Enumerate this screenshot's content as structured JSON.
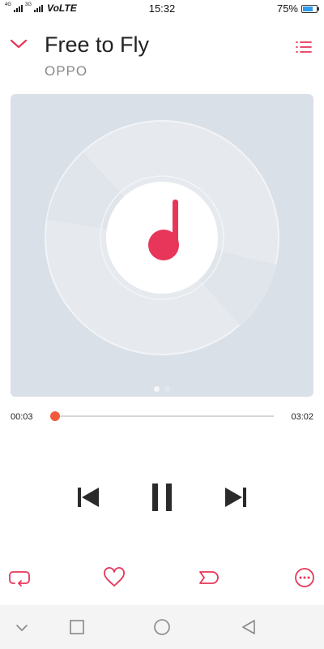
{
  "status_bar": {
    "network_tag_1": "4G",
    "network_tag_2": "3G",
    "volte": "VoLTE",
    "time": "15:32",
    "battery_percent": "75%",
    "battery_level": 0.75,
    "battery_color": "#2f9cf0"
  },
  "player": {
    "title": "Free to Fly",
    "artist": "OPPO",
    "elapsed": "00:03",
    "total": "03:02",
    "progress": 0.02,
    "accent_color": "#e8355a",
    "progress_color": "#f05a3c",
    "artwork_icon": "music-note-icon",
    "artwork_pages": 2,
    "artwork_active_page": 1
  },
  "controls": {
    "previous_icon": "skip-previous-icon",
    "play_pause_icon": "pause-icon",
    "next_icon": "skip-next-icon"
  },
  "actions": {
    "collapse_icon": "chevron-down-icon",
    "playlist_icon": "playlist-icon",
    "loop_icon": "repeat-icon",
    "favorite_icon": "heart-icon",
    "queue_icon": "queue-tag-icon",
    "more_icon": "more-icon"
  },
  "nav_bar": {
    "icons": [
      "nav-chevron-down-icon",
      "recents-square-icon",
      "home-circle-icon",
      "back-triangle-icon"
    ]
  }
}
